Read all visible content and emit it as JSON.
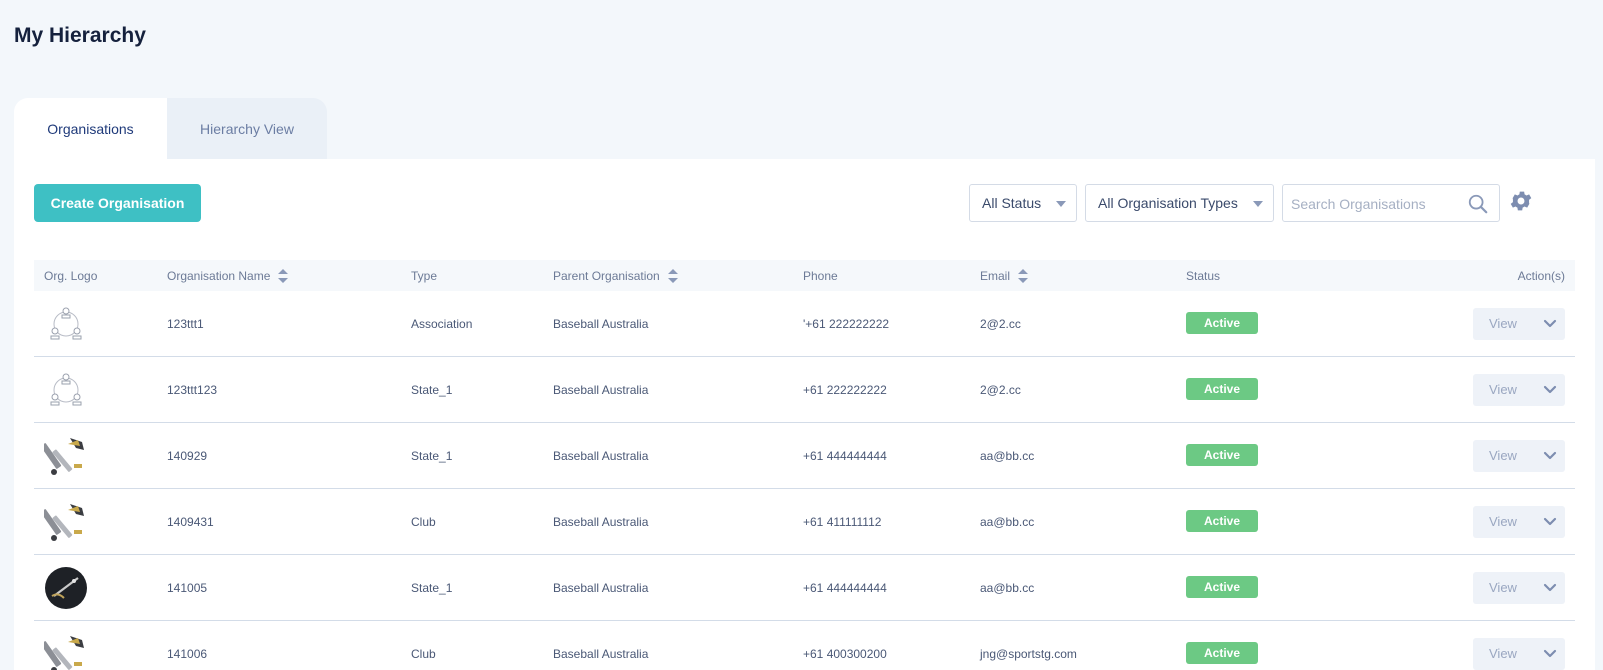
{
  "page": {
    "title": "My Hierarchy"
  },
  "tabs": [
    {
      "label": "Organisations",
      "active": true
    },
    {
      "label": "Hierarchy View",
      "active": false
    }
  ],
  "toolbar": {
    "create_label": "Create Organisation",
    "status_filter": "All Status",
    "type_filter": "All Organisation Types",
    "search_placeholder": "Search Organisations"
  },
  "table": {
    "columns": {
      "logo": "Org. Logo",
      "name": "Organisation Name",
      "type": "Type",
      "parent": "Parent Organisation",
      "phone": "Phone",
      "email": "Email",
      "status": "Status",
      "actions": "Action(s)"
    },
    "rows": [
      {
        "logo": "hierarchy-placeholder",
        "name": "123ttt1",
        "type": "Association",
        "parent": "Baseball Australia",
        "phone": "'+61 222222222",
        "email": "2@2.cc",
        "status": "Active",
        "action": "View"
      },
      {
        "logo": "hierarchy-placeholder",
        "name": "123ttt123",
        "type": "State_1",
        "parent": "Baseball Australia",
        "phone": "+61 222222222",
        "email": "2@2.cc",
        "status": "Active",
        "action": "View"
      },
      {
        "logo": "tools",
        "name": "140929",
        "type": "State_1",
        "parent": "Baseball Australia",
        "phone": "+61 444444444",
        "email": "aa@bb.cc",
        "status": "Active",
        "action": "View"
      },
      {
        "logo": "tools",
        "name": "1409431",
        "type": "Club",
        "parent": "Baseball Australia",
        "phone": "+61 411111112",
        "email": "aa@bb.cc",
        "status": "Active",
        "action": "View"
      },
      {
        "logo": "dark-circle",
        "name": "141005",
        "type": "State_1",
        "parent": "Baseball Australia",
        "phone": "+61 444444444",
        "email": "aa@bb.cc",
        "status": "Active",
        "action": "View"
      },
      {
        "logo": "tools",
        "name": "141006",
        "type": "Club",
        "parent": "Baseball Australia",
        "phone": "+61 400300200",
        "email": "jng@sportstg.com",
        "status": "Active",
        "action": "View"
      }
    ]
  },
  "colors": {
    "accent": "#3ec0c4",
    "active_badge": "#6cc984",
    "background": "#f3f7fb"
  }
}
